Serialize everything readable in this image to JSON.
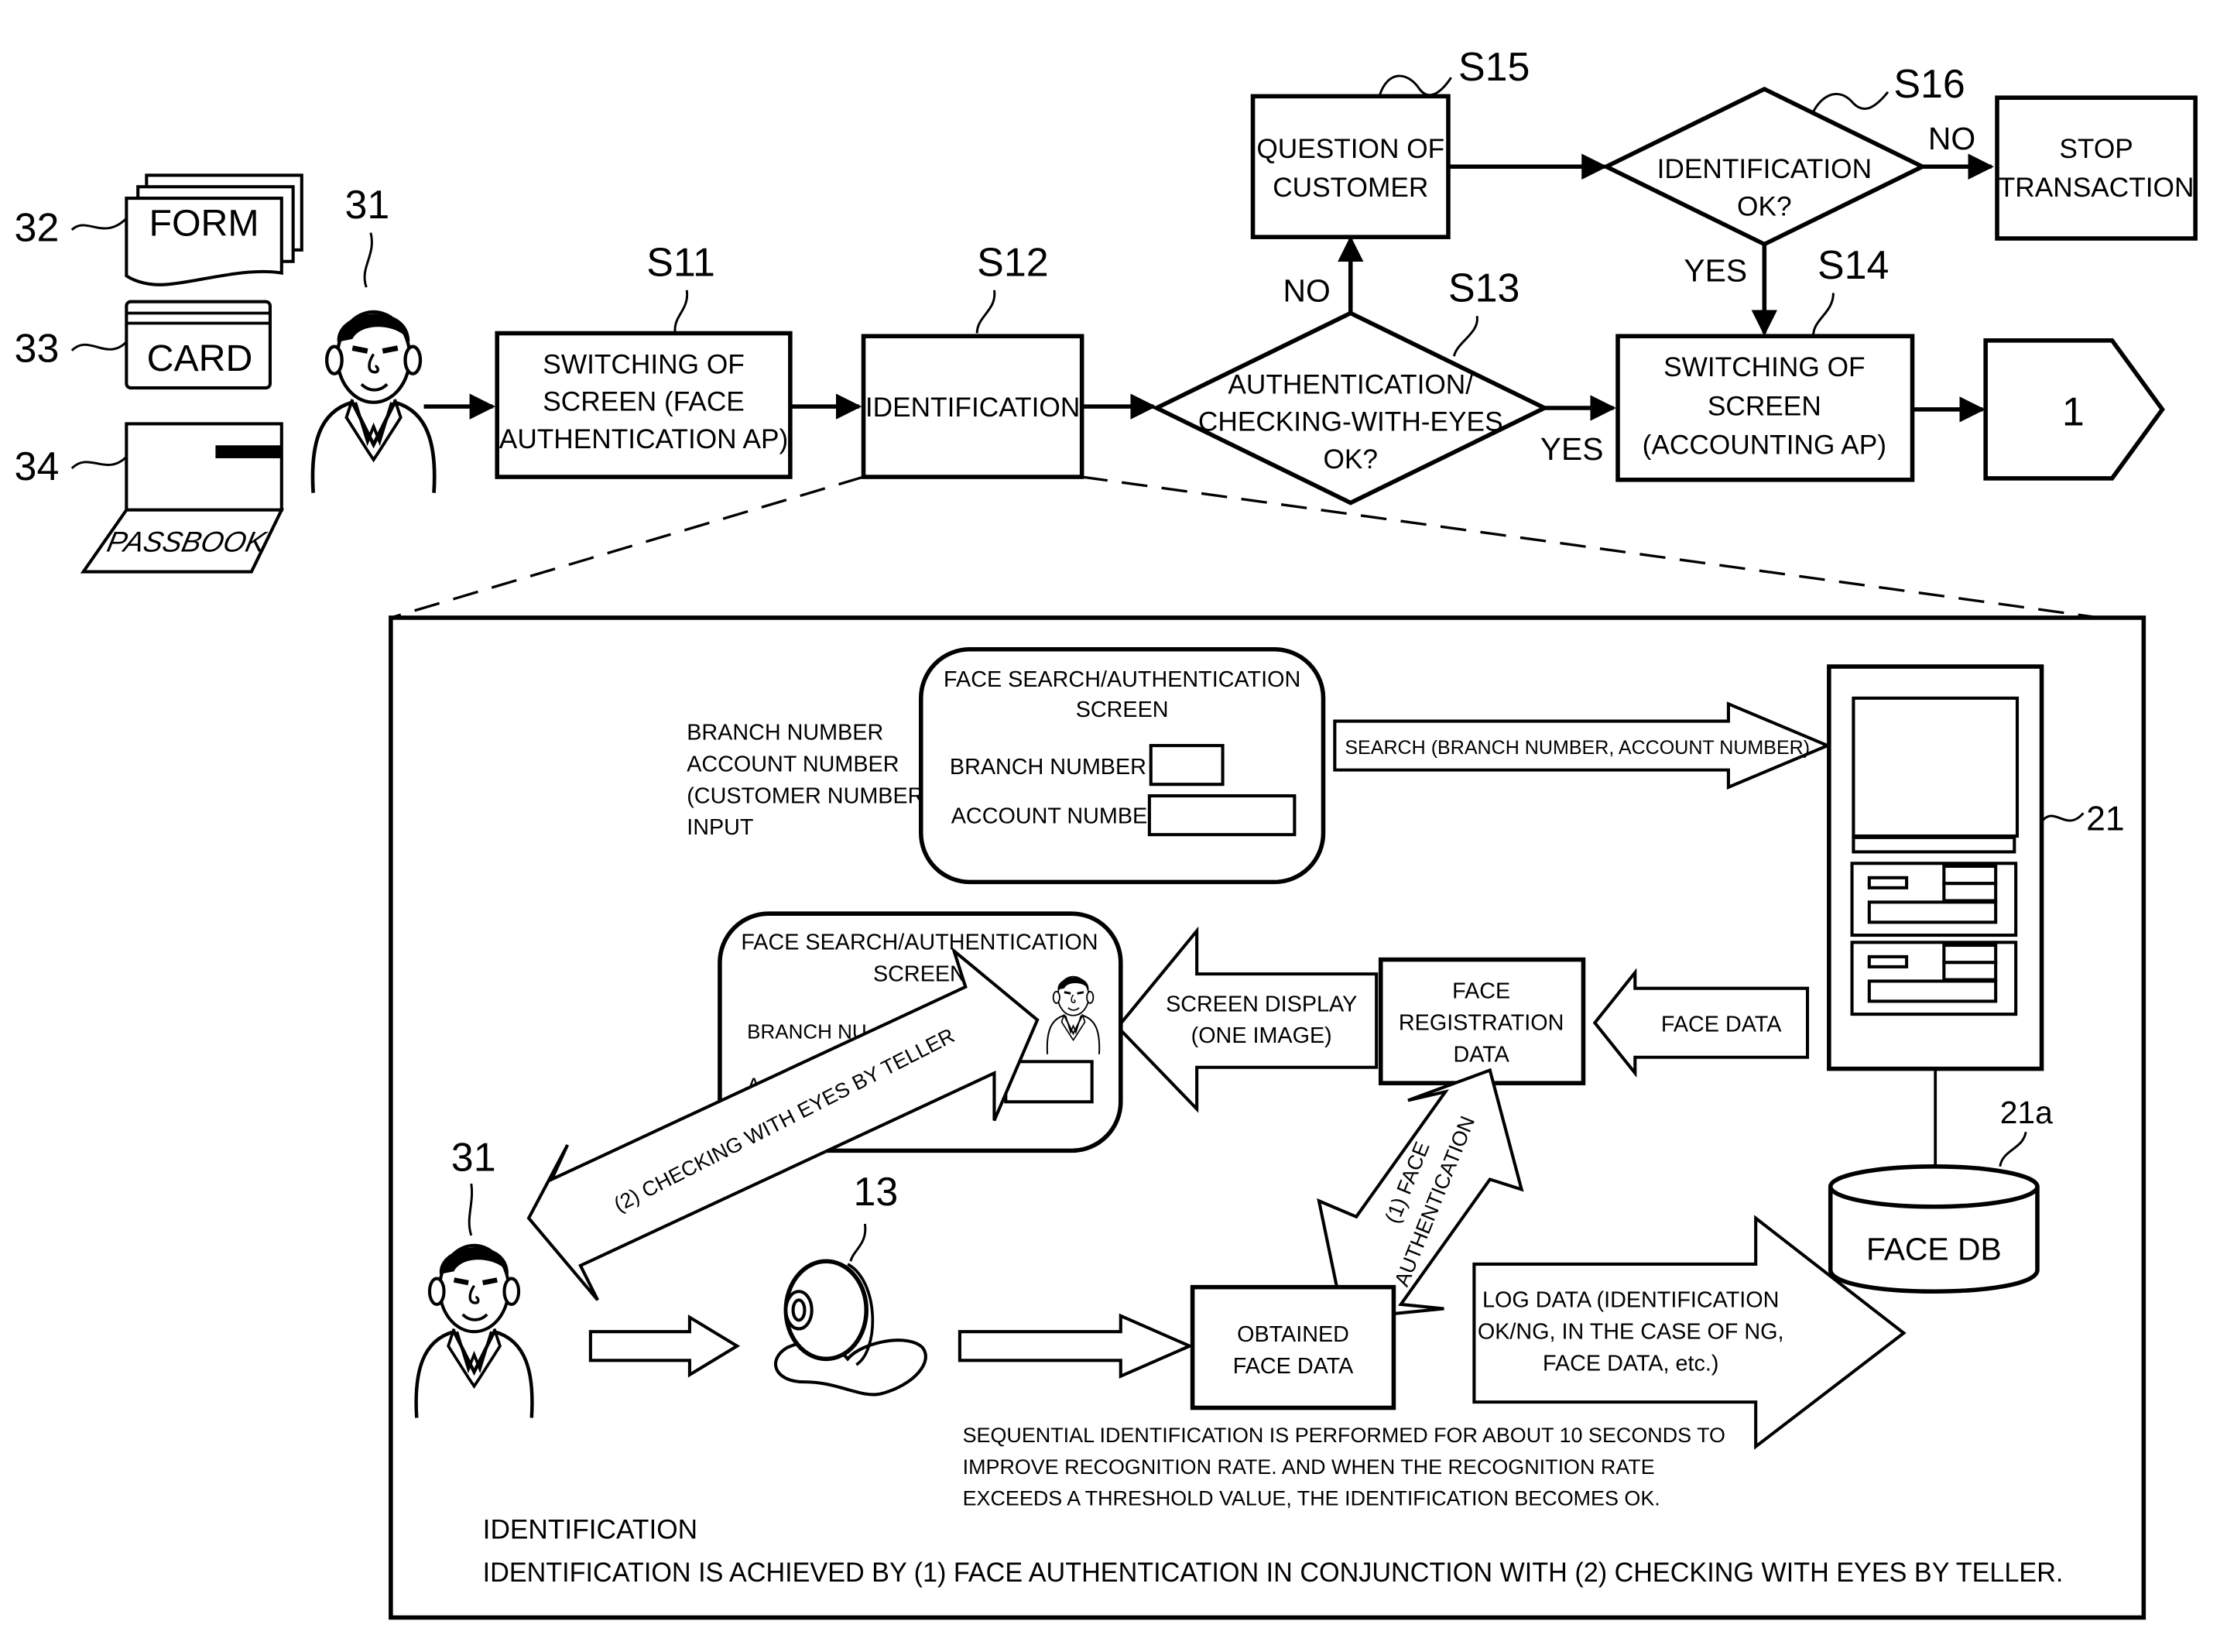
{
  "diagram": {
    "items": {
      "form": {
        "ref": "32",
        "label": "FORM"
      },
      "card": {
        "ref": "33",
        "label": "CARD"
      },
      "passbook": {
        "ref": "34",
        "label": "PASSBOOK"
      },
      "customer": {
        "ref": "31"
      }
    },
    "flow": {
      "s11": {
        "step": "S11",
        "lines": [
          "SWITCHING OF",
          "SCREEN (FACE",
          "AUTHENTICATION AP)"
        ]
      },
      "s12": {
        "step": "S12",
        "lines": [
          "IDENTIFICATION"
        ]
      },
      "s13": {
        "step": "S13",
        "lines": [
          "AUTHENTICATION/",
          "CHECKING-WITH-EYES",
          "OK?"
        ],
        "yes": "YES",
        "no": "NO"
      },
      "s14": {
        "step": "S14",
        "lines": [
          "SWITCHING OF",
          "SCREEN",
          "(ACCOUNTING AP)"
        ]
      },
      "s15": {
        "step": "S15",
        "lines": [
          "QUESTION OF",
          "CUSTOMER"
        ]
      },
      "s16": {
        "step": "S16",
        "lines": [
          "IDENTIFICATION",
          "OK?"
        ],
        "yes": "YES",
        "no": "NO"
      },
      "stop": {
        "lines": [
          "STOP",
          "TRANSACTION"
        ]
      },
      "connector": {
        "label": "1"
      }
    },
    "detail": {
      "input_note": [
        "BRANCH NUMBER",
        "ACCOUNT NUMBER",
        "(CUSTOMER NUMBER)",
        "INPUT"
      ],
      "screen1": {
        "title": [
          "FACE SEARCH/AUTHENTICATION",
          "SCREEN"
        ],
        "branch_label": "BRANCH NUMBER",
        "account_label": "ACCOUNT NUMBER"
      },
      "search_arrow": "SEARCH (BRANCH NUMBER, ACCOUNT NUMBER)",
      "server": {
        "ref": "21"
      },
      "face_db": {
        "ref": "21a",
        "label": "FACE DB"
      },
      "screen2": {
        "title": [
          "FACE SEARCH/AUTHENTICATION",
          "SCREEN"
        ],
        "branch_label": "BRANCH NU",
        "account_label": "AC"
      },
      "screen_display_arrow": [
        "SCREEN DISPLAY",
        "(ONE IMAGE)"
      ],
      "face_registration": [
        "FACE",
        "REGISTRATION",
        "DATA"
      ],
      "face_data_arrow": "FACE DATA",
      "checking_arrow": "(2) CHECKING WITH EYES BY TELLER",
      "face_auth_arrow": [
        "(1) FACE",
        "AUTHENTICATION"
      ],
      "customer_ref": "31",
      "camera_ref": "13",
      "obtained": [
        "OBTAINED",
        "FACE DATA"
      ],
      "log_arrow": [
        "LOG DATA (IDENTIFICATION",
        "OK/NG, IN THE CASE OF NG,",
        "FACE DATA, etc.)"
      ],
      "sequential_note": [
        "SEQUENTIAL IDENTIFICATION IS PERFORMED FOR ABOUT 10 SECONDS TO",
        "IMPROVE RECOGNITION RATE.  AND WHEN THE RECOGNITION RATE",
        "EXCEEDS A THRESHOLD VALUE, THE IDENTIFICATION BECOMES OK."
      ],
      "summary_title": "IDENTIFICATION",
      "summary_text": "IDENTIFICATION IS ACHIEVED BY (1) FACE AUTHENTICATION IN CONJUNCTION WITH (2) CHECKING WITH EYES BY TELLER."
    }
  }
}
